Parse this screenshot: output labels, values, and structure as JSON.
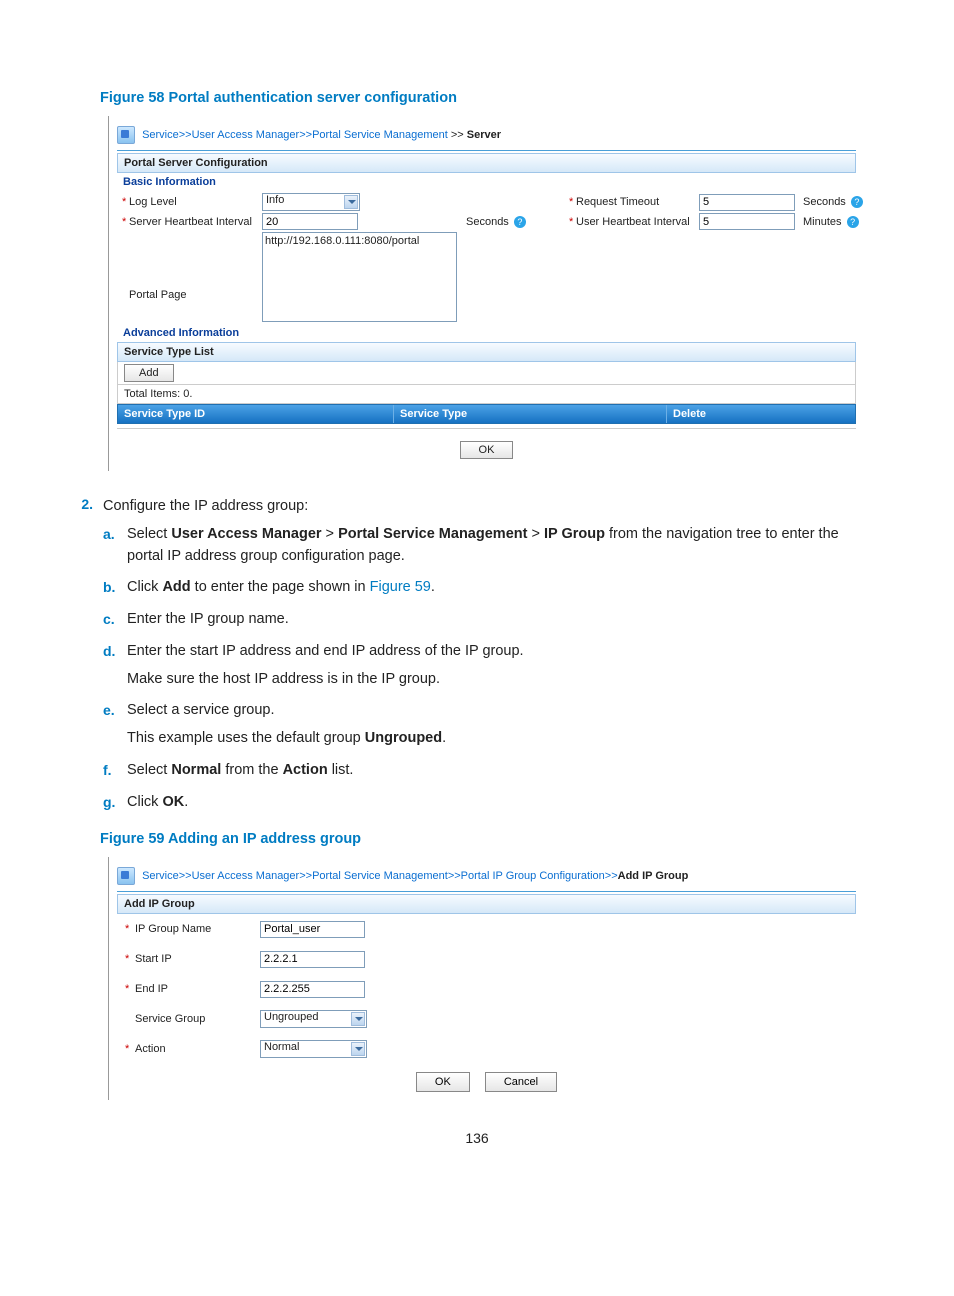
{
  "figure58": {
    "caption": "Figure 58 Portal authentication server configuration",
    "breadcrumb": {
      "svc": "Service",
      "uam": "User Access Manager",
      "psm": "Portal Service Management",
      "server": "Server",
      "sep": ">>"
    },
    "section": "Portal Server Configuration",
    "basic": "Basic Information",
    "advanced": "Advanced Information",
    "labels": {
      "log_level": "Log Level",
      "server_hb": "Server Heartbeat Interval",
      "portal_page": "Portal Page",
      "req_timeout": "Request Timeout",
      "user_hb": "User Heartbeat Interval",
      "seconds": "Seconds",
      "minutes": "Minutes"
    },
    "values": {
      "log_level": "Info",
      "server_hb": "20",
      "req_timeout": "5",
      "user_hb": "5",
      "portal_page": "http://192.168.0.111:8080/portal"
    },
    "svc_list": "Service Type List",
    "add": "Add",
    "total": "Total Items: 0.",
    "cols": {
      "id": "Service Type ID",
      "type": "Service Type",
      "del": "Delete"
    },
    "ok": "OK",
    "help": "?"
  },
  "step2": {
    "num": "2.",
    "text": "Configure the IP address group:",
    "items": {
      "a": {
        "l": "a.",
        "t1": "Select ",
        "b1": "User Access Manager",
        "g": " > ",
        "b2": "Portal Service Management",
        "b3": "IP Group",
        "t2": " from the navigation tree to enter the portal IP address group configuration page."
      },
      "b": {
        "l": "b.",
        "t1": "Click ",
        "b1": "Add",
        "t2": " to enter the page shown in ",
        "link": "Figure 59",
        "t3": "."
      },
      "c": {
        "l": "c.",
        "t": "Enter the IP group name."
      },
      "d": {
        "l": "d.",
        "t1": "Enter the start IP address and end IP address of the IP group.",
        "t2": "Make sure the host IP address is in the IP group."
      },
      "e": {
        "l": "e.",
        "t1": "Select a service group.",
        "t2": "This example uses the default group ",
        "b": "Ungrouped",
        "t3": "."
      },
      "f": {
        "l": "f.",
        "t1": "Select ",
        "b1": "Normal",
        "t2": " from the ",
        "b2": "Action",
        "t3": " list."
      },
      "g": {
        "l": "g.",
        "t1": "Click ",
        "b1": "OK",
        "t2": "."
      }
    }
  },
  "figure59": {
    "caption": "Figure 59 Adding an IP address group",
    "breadcrumb": {
      "svc": "Service",
      "uam": "User Access Manager",
      "psm": "Portal Service Management",
      "cfg": "Portal IP Group Configuration",
      "add": "Add IP Group",
      "sep": ">>"
    },
    "section": "Add IP Group",
    "labels": {
      "name": "IP Group Name",
      "start": "Start IP",
      "end": "End IP",
      "sg": "Service Group",
      "action": "Action"
    },
    "values": {
      "name": "Portal_user",
      "start": "2.2.2.1",
      "end": "2.2.2.255",
      "sg": "Ungrouped",
      "action": "Normal"
    },
    "ok": "OK",
    "cancel": "Cancel"
  },
  "page_number": "136"
}
